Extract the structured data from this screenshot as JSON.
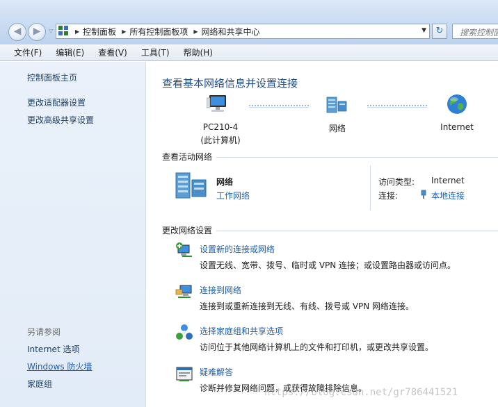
{
  "address_bar": {
    "back_icon": "back-arrow-icon",
    "forward_icon": "forward-arrow-icon",
    "breadcrumbs": [
      "控制面板",
      "所有控制面板项",
      "网络和共享中心"
    ],
    "search_placeholder": "搜索控制面板"
  },
  "menu": [
    "文件(F)",
    "编辑(E)",
    "查看(V)",
    "工具(T)",
    "帮助(H)"
  ],
  "sidebar": {
    "home": "控制面板主页",
    "links": [
      "更改适配器设置",
      "更改高级共享设置"
    ],
    "see_also_title": "另请参阅",
    "see_also": [
      "Internet 选项",
      "Windows 防火墙",
      "家庭组"
    ]
  },
  "main": {
    "title": "查看基本网络信息并设置连接",
    "map": {
      "computer_name": "PC210-4",
      "computer_sub": "(此计算机)",
      "network": "网络",
      "internet": "Internet"
    },
    "active_section": "查看活动网络",
    "active": {
      "name": "网络",
      "type": "工作网络",
      "access_type_label": "访问类型:",
      "access_type_value": "Internet",
      "connection_label": "连接:",
      "connection_value": "本地连接"
    },
    "change_section": "更改网络设置",
    "tasks": [
      {
        "title": "设置新的连接或网络",
        "desc": "设置无线、宽带、拨号、临时或 VPN 连接；或设置路由器或访问点。",
        "icon": "new-connection-icon"
      },
      {
        "title": "连接到网络",
        "desc": "连接到或重新连接到无线、有线、拨号或 VPN 网络连接。",
        "icon": "connect-network-icon"
      },
      {
        "title": "选择家庭组和共享选项",
        "desc": "访问位于其他网络计算机上的文件和打印机，或更改共享设置。",
        "icon": "homegroup-icon"
      },
      {
        "title": "疑难解答",
        "desc": "诊断并修复网络问题，或获得故障排除信息。",
        "icon": "troubleshoot-icon"
      }
    ]
  },
  "watermark": "https://blog.csdn.net/gr786441521",
  "colors": {
    "link": "#1e5fae",
    "title": "#1e4e8c",
    "sidebar_bg": "#e2ecf8"
  }
}
